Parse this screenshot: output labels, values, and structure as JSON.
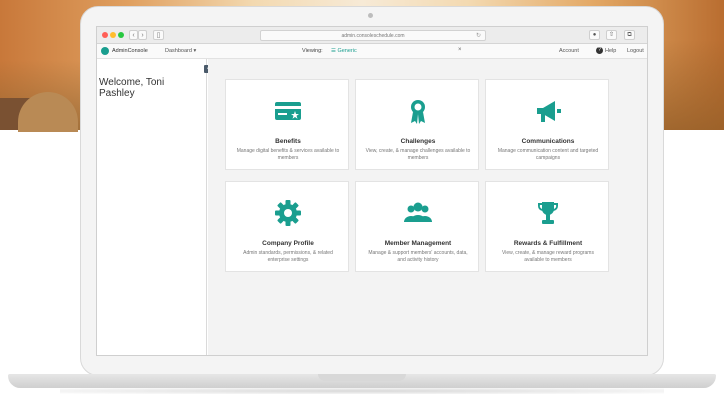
{
  "browser": {
    "url": "admin.consoleschedule.com"
  },
  "appbar": {
    "logo_text": "AdminConsole",
    "dashboard_select": "Dashboard",
    "viewing_label": "Viewing:",
    "viewing_value": "Generic",
    "viewing_close": "×",
    "account": "Account",
    "help": "Help",
    "logout": "Logout"
  },
  "sidebar": {
    "welcome": "Welcome, Toni Pashley"
  },
  "cards": [
    {
      "title": "Benefits",
      "description": "Manage digital benefits & services available to members",
      "icon": "card-icon"
    },
    {
      "title": "Challenges",
      "description": "View, create, & manage challenges available to members",
      "icon": "award-ribbon-icon"
    },
    {
      "title": "Communications",
      "description": "Manage communication content and targeted campaigns",
      "icon": "megaphone-icon"
    },
    {
      "title": "Company Profile",
      "description": "Admin standards, permissions, & related enterprise settings",
      "icon": "gear-icon"
    },
    {
      "title": "Member Management",
      "description": "Manage & support members' accounts, data, and activity history",
      "icon": "group-icon"
    },
    {
      "title": "Rewards & Fulfillment",
      "description": "View, create, & manage reward programs available to members",
      "icon": "trophy-icon"
    }
  ],
  "colors": {
    "accent": "#1a9e8f"
  }
}
